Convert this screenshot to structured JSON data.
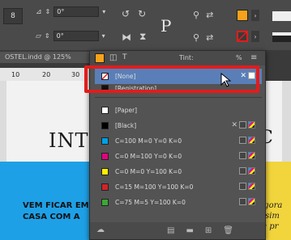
{
  "toolbar": {
    "num_field_1": "0°",
    "num_field_2": "0°",
    "p_glyph": "P",
    "ref_point_label": "8"
  },
  "document": {
    "tab_title": "OSTEL.indd @ 125%",
    "ruler_marks": [
      "10",
      "20",
      "30"
    ],
    "heading_left": "INT",
    "heading_right": "C",
    "blue_text_line1": "VEM FICAR EM",
    "blue_text_line2": "CASA COM A",
    "yellow_text_line1": "Agora",
    "yellow_text_line2": "é sim",
    "yellow_text_line3": "se pr"
  },
  "swatches_panel": {
    "tint_label": "Tint:",
    "percent_label": "%",
    "rows": [
      {
        "name": "[None]",
        "color": "#ffffff",
        "selected": true
      },
      {
        "name": "[Registration]",
        "color": "#111111",
        "selected": false
      },
      {
        "name": "[Paper]",
        "color": "#ffffff",
        "selected": false
      },
      {
        "name": "[Black]",
        "color": "#000000",
        "selected": false
      },
      {
        "name": "C=100 M=0 Y=0 K=0",
        "color": "#00a0e6",
        "selected": false
      },
      {
        "name": "C=0 M=100 Y=0 K=0",
        "color": "#e6007e",
        "selected": false
      },
      {
        "name": "C=0 M=0 Y=100 K=0",
        "color": "#fff000",
        "selected": false
      },
      {
        "name": "C=15 M=100 Y=100 K=0",
        "color": "#d2232a",
        "selected": false
      },
      {
        "name": "C=75 M=5 Y=100 K=0",
        "color": "#3aa935",
        "selected": false
      }
    ]
  },
  "colors": {
    "highlight_box": "#e51b1b",
    "selection": "#5a7fb8",
    "toolbar_fill_swatch": "#f7a21b"
  }
}
